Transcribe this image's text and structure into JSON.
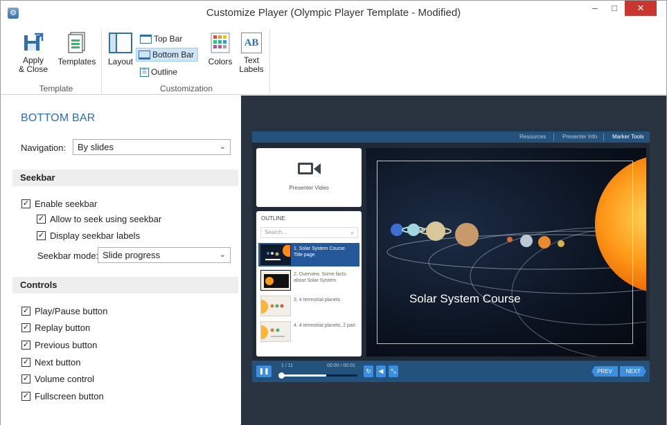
{
  "window": {
    "title": "Customize Player (Olympic Player Template - Modified)",
    "minimize": "–",
    "maximize": "□",
    "close": "✕"
  },
  "ribbon": {
    "apply_close": [
      "Apply",
      "& Close"
    ],
    "templates": "Templates",
    "group_template": "Template",
    "layout": "Layout",
    "top_bar": "Top Bar",
    "bottom_bar": "Bottom Bar",
    "outline": "Outline",
    "colors": "Colors",
    "text_labels": [
      "Text",
      "Labels"
    ],
    "text_labels_icon": "AB",
    "group_customization": "Customization"
  },
  "panel": {
    "title": "BOTTOM BAR",
    "navigation_label": "Navigation:",
    "navigation_value": "By slides",
    "seekbar_section": "Seekbar",
    "enable_seekbar": "Enable seekbar",
    "allow_seek": "Allow to seek using seekbar",
    "display_labels": "Display seekbar labels",
    "seekbar_mode_label": "Seekbar mode:",
    "seekbar_mode_value": "Slide progress",
    "controls_section": "Controls",
    "controls": [
      "Play/Pause button",
      "Replay button",
      "Previous button",
      "Next button",
      "Volume control",
      "Fullscreen button"
    ]
  },
  "preview": {
    "topbar_links": [
      "Resources",
      "Presenter Info",
      "Marker Tools"
    ],
    "presenter_video": "Presenter Video",
    "outline_title": "OUTLINE",
    "search_placeholder": "Search...",
    "outline_items": [
      "1. Solar System Course. Title page",
      "2. Overview. Some facts about Solar System",
      "3. 4 terrestrial planets",
      "4. 4 terrestrial planets, 2 part"
    ],
    "slide_title": "Solar System Course",
    "slide_counter": "1 / 11",
    "time": "00:00 / 00:01",
    "seek_progress": 0.6,
    "prev": "PREV",
    "next": "NEXT"
  }
}
